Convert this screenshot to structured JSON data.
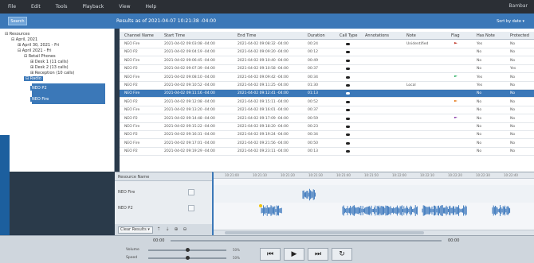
{
  "menubar": {
    "items": [
      "File",
      "Edit",
      "Tools",
      "Playback",
      "View",
      "Help"
    ],
    "user": "Bambar"
  },
  "toolbar": {
    "button": "Search",
    "title": "Results as of 2021-04-07 10:21:38 -04:00",
    "right": "Sort by date ▾"
  },
  "tree": [
    {
      "label": "Resources",
      "indent": 0,
      "prefix": "⊟"
    },
    {
      "label": "April, 2021",
      "indent": 1,
      "prefix": "⊟"
    },
    {
      "label": "April 30, 2021 - Fri",
      "indent": 2,
      "prefix": "⊞"
    },
    {
      "label": "April 2021 - Fri",
      "indent": 2,
      "prefix": "⊟"
    },
    {
      "label": "Retail Phones",
      "indent": 3,
      "prefix": "⊟"
    },
    {
      "label": "Desk 1 (11 calls)",
      "indent": 4,
      "prefix": "⊞"
    },
    {
      "label": "Desk 2 (13 calls)",
      "indent": 4,
      "prefix": "⊞"
    },
    {
      "label": "Reception (10 calls)",
      "indent": 4,
      "prefix": "⊞"
    },
    {
      "label": "Radio",
      "indent": 3,
      "prefix": "⊟"
    },
    {
      "label": "NEO P2",
      "indent": 4,
      "prefix": ""
    },
    {
      "label": "NEO Fire",
      "indent": 4,
      "prefix": ""
    }
  ],
  "columns": [
    "Channel Name",
    "Start Time",
    "End Time",
    "Duration",
    "Call Type",
    "Annotations",
    "Note",
    "Flag",
    "Has Note",
    "Protected"
  ],
  "rows": [
    {
      "ch": "NEO Fire",
      "start": "2021-04-02 09:03:08 -04:00",
      "end": "2021-04-02 09:08:32 -04:00",
      "dur": "00:24",
      "note": "Unidentified",
      "flag": "#c0392b",
      "has": "Yes",
      "prot": "No"
    },
    {
      "ch": "NEO P2",
      "start": "2021-04-02 09:04:19 -04:00",
      "end": "2021-04-02 09:09:20 -04:00",
      "dur": "00:12",
      "note": "",
      "flag": "",
      "has": "No",
      "prot": "No"
    },
    {
      "ch": "NEO Fire",
      "start": "2021-04-02 09:06:45 -04:00",
      "end": "2021-04-02 09:10:40 -04:00",
      "dur": "00:49",
      "note": "",
      "flag": "",
      "has": "No",
      "prot": "No"
    },
    {
      "ch": "NEO P2",
      "start": "2021-04-02 09:07:39 -04:00",
      "end": "2021-04-02 09:10:58 -04:00",
      "dur": "00:37",
      "note": "",
      "flag": "",
      "has": "No",
      "prot": "Yes"
    },
    {
      "ch": "NEO Fire",
      "start": "2021-04-02 09:08:10 -04:00",
      "end": "2021-04-02 09:09:42 -04:00",
      "dur": "00:34",
      "note": "",
      "flag": "#27ae60",
      "has": "Yes",
      "prot": "No"
    },
    {
      "ch": "NEO P2",
      "start": "2021-04-02 09:10:52 -04:00",
      "end": "2021-04-02 09:11:25 -04:00",
      "dur": "01:30",
      "note": "Local",
      "flag": "",
      "has": "Yes",
      "prot": "No"
    },
    {
      "ch": "NEO Fire",
      "start": "2021-04-02 09:11:16 -04:00",
      "end": "2021-04-02 09:12:41 -04:00",
      "dur": "01:13",
      "note": "",
      "flag": "",
      "has": "No",
      "prot": "No"
    },
    {
      "ch": "NEO P2",
      "start": "2021-04-02 09:12:08 -04:00",
      "end": "2021-04-02 09:15:11 -04:00",
      "dur": "00:52",
      "note": "",
      "flag": "#e67e22",
      "has": "No",
      "prot": "No"
    },
    {
      "ch": "NEO Fire",
      "start": "2021-04-02 09:13:20 -04:00",
      "end": "2021-04-02 09:16:01 -04:00",
      "dur": "00:37",
      "note": "",
      "flag": "",
      "has": "No",
      "prot": "No"
    },
    {
      "ch": "NEO P2",
      "start": "2021-04-02 09:14:48 -04:00",
      "end": "2021-04-02 09:17:09 -04:00",
      "dur": "00:59",
      "note": "",
      "flag": "#8e44ad",
      "has": "No",
      "prot": "No"
    },
    {
      "ch": "NEO Fire",
      "start": "2021-04-02 09:15:22 -04:00",
      "end": "2021-04-02 09:18:20 -04:00",
      "dur": "00:23",
      "note": "",
      "flag": "",
      "has": "No",
      "prot": "No"
    },
    {
      "ch": "NEO P2",
      "start": "2021-04-02 09:16:31 -04:00",
      "end": "2021-04-02 09:19:24 -04:00",
      "dur": "00:34",
      "note": "",
      "flag": "",
      "has": "No",
      "prot": "No"
    },
    {
      "ch": "NEO Fire",
      "start": "2021-04-02 09:17:01 -04:00",
      "end": "2021-04-02 09:21:56 -04:00",
      "dur": "00:50",
      "note": "",
      "flag": "",
      "has": "No",
      "prot": "No"
    },
    {
      "ch": "NEO P2",
      "start": "2021-04-02 09:19:29 -04:00",
      "end": "2021-04-02 09:23:11 -04:00",
      "dur": "00:13",
      "note": "",
      "flag": "",
      "has": "No",
      "prot": "No"
    }
  ],
  "selected_row": 6,
  "resources": {
    "header": "Resource Name",
    "items": [
      "NEO Fire",
      "NEO P2"
    ],
    "select": "Clear Results"
  },
  "wave": {
    "ruler": [
      "10:21:00",
      "10:21:10",
      "10:21:20",
      "10:21:30",
      "10:21:40",
      "10:21:50",
      "10:22:00",
      "10:22:10",
      "10:22:20",
      "10:22:30",
      "10:22:40"
    ]
  },
  "bottom": {
    "time_left": "00:00",
    "time_right": "00:00",
    "volume_label": "Volume",
    "speed_label": "Speed",
    "volume_pct": "50%",
    "speed_pct": "50%",
    "volume": 0.5,
    "speed": 0.5
  }
}
